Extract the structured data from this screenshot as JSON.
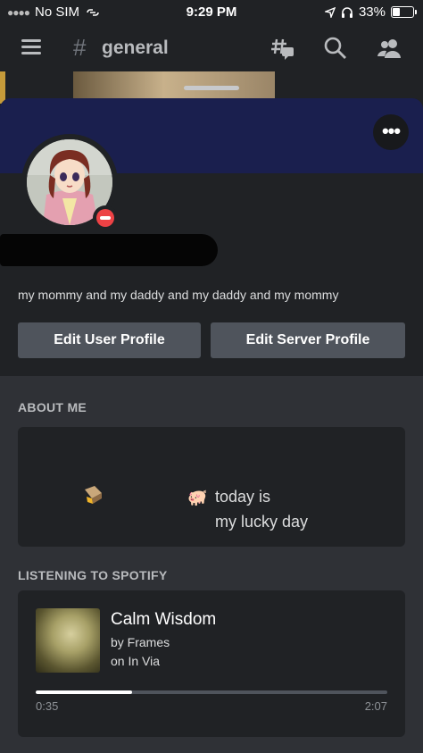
{
  "status_bar": {
    "carrier": "No SIM",
    "time": "9:29 PM",
    "battery": "33%",
    "battery_level": 0.33
  },
  "header": {
    "channel_hash": "#",
    "channel_name": "general",
    "icons": [
      "hamburger-icon",
      "threads-icon",
      "search-icon",
      "members-icon"
    ]
  },
  "profile": {
    "bio": "my mommy and my daddy and my daddy and my mommy",
    "status": "do-not-disturb",
    "banner_color": "#1a1f4e",
    "edit_user_label": "Edit User Profile",
    "edit_server_label": "Edit Server Profile"
  },
  "about": {
    "title": "ABOUT ME",
    "line1": "today is",
    "line2": "my lucky day",
    "emoji_pig": "🐖"
  },
  "spotify": {
    "title": "LISTENING TO SPOTIFY",
    "track": "Calm Wisdom",
    "artist": "by Frames",
    "album": "on In Via",
    "elapsed": "0:35",
    "total": "2:07",
    "progress": 0.275
  }
}
